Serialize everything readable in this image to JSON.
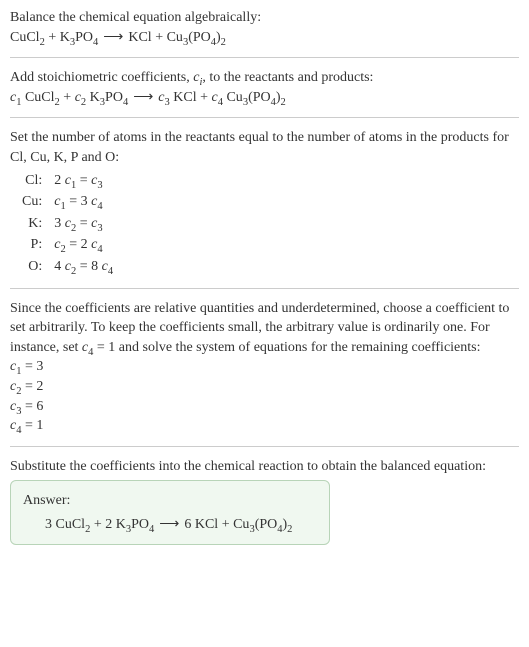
{
  "s1": {
    "line1": "Balance the chemical equation algebraically:"
  },
  "s2": {
    "line1_a": "Add stoichiometric coefficients, ",
    "line1_ci": "c",
    "line1_ci_sub": "i",
    "line1_b": ", to the reactants and products:"
  },
  "s3": {
    "line1": "Set the number of atoms in the reactants equal to the number of atoms in the products for Cl, Cu, K, P and O:"
  },
  "eqs": [
    {
      "elem": "Cl:",
      "lhs_coef": "2 ",
      "lhs_var": "c",
      "lhs_sub": "1",
      "eqs": " = ",
      "rhs_coef": "",
      "rhs_var": "c",
      "rhs_sub": "3"
    },
    {
      "elem": "Cu:",
      "lhs_coef": "",
      "lhs_var": "c",
      "lhs_sub": "1",
      "eqs": " = 3 ",
      "rhs_coef": "",
      "rhs_var": "c",
      "rhs_sub": "4"
    },
    {
      "elem": "K:",
      "lhs_coef": "3 ",
      "lhs_var": "c",
      "lhs_sub": "2",
      "eqs": " = ",
      "rhs_coef": "",
      "rhs_var": "c",
      "rhs_sub": "3"
    },
    {
      "elem": "P:",
      "lhs_coef": "",
      "lhs_var": "c",
      "lhs_sub": "2",
      "eqs": " = 2 ",
      "rhs_coef": "",
      "rhs_var": "c",
      "rhs_sub": "4"
    },
    {
      "elem": "O:",
      "lhs_coef": "4 ",
      "lhs_var": "c",
      "lhs_sub": "2",
      "eqs": " = 8 ",
      "rhs_coef": "",
      "rhs_var": "c",
      "rhs_sub": "4"
    }
  ],
  "s4": {
    "line1_a": "Since the coefficients are relative quantities and underdetermined, choose a coefficient to set arbitrarily. To keep the coefficients small, the arbitrary value is ordinarily one. For instance, set ",
    "line1_c": "c",
    "line1_csub": "4",
    "line1_b": " = 1 and solve the system of equations for the remaining coefficients:"
  },
  "coefs": [
    {
      "var": "c",
      "sub": "1",
      "val": " = 3"
    },
    {
      "var": "c",
      "sub": "2",
      "val": " = 2"
    },
    {
      "var": "c",
      "sub": "3",
      "val": " = 6"
    },
    {
      "var": "c",
      "sub": "4",
      "val": " = 1"
    }
  ],
  "s5": {
    "line1": "Substitute the coefficients into the chemical reaction to obtain the balanced equation:"
  },
  "answer": {
    "label": "Answer:"
  },
  "chem": {
    "CuCl2_a": "CuCl",
    "CuCl2_b": "2",
    "K3PO4_a": "K",
    "K3PO4_b": "3",
    "K3PO4_c": "PO",
    "K3PO4_d": "4",
    "KCl": "KCl",
    "Cu3PO42_a": "Cu",
    "Cu3PO42_b": "3",
    "Cu3PO42_c": "(PO",
    "Cu3PO42_d": "4",
    "Cu3PO42_e": ")",
    "Cu3PO42_f": "2",
    "plus": " + ",
    "arrow": "⟶",
    "sp": " "
  },
  "coefvars": {
    "c": "c",
    "s1": "1",
    "s2": "2",
    "s3": "3",
    "s4": "4"
  },
  "nums": {
    "n3": "3 ",
    "n2": "2 ",
    "n6": "6 "
  }
}
